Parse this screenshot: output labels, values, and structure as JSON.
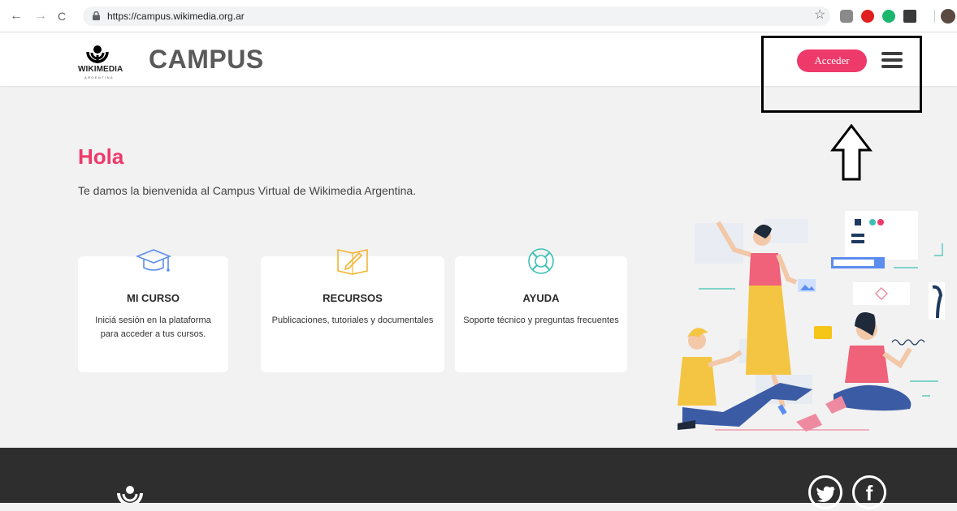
{
  "browser": {
    "url": "https://campus.wikimedia.org.ar",
    "back_icon": "←",
    "forward_icon": "→",
    "reload_icon": "C",
    "star_icon": "☆"
  },
  "header": {
    "logo_word": "WIKIMEDIA",
    "logo_sub": "ARGENTINA",
    "title": "CAMPUS",
    "login_label": "Acceder",
    "accent_color": "#ee3a6a"
  },
  "hero": {
    "greeting": "Hola",
    "welcome": "Te damos la bienvenida al Campus Virtual de Wikimedia Argentina."
  },
  "cards": [
    {
      "icon": "graduation-cap-icon",
      "title": "MI CURSO",
      "desc": "Iniciá sesión en la plataforma para acceder a tus cursos."
    },
    {
      "icon": "book-pen-icon",
      "title": "RECURSOS",
      "desc": "Publicaciones, tutoriales y documentales"
    },
    {
      "icon": "lifebuoy-icon",
      "title": "AYUDA",
      "desc": "Soporte técnico y preguntas frecuentes"
    }
  ],
  "footer": {
    "twitter_icon": "twitter-icon",
    "facebook_label": "f"
  }
}
